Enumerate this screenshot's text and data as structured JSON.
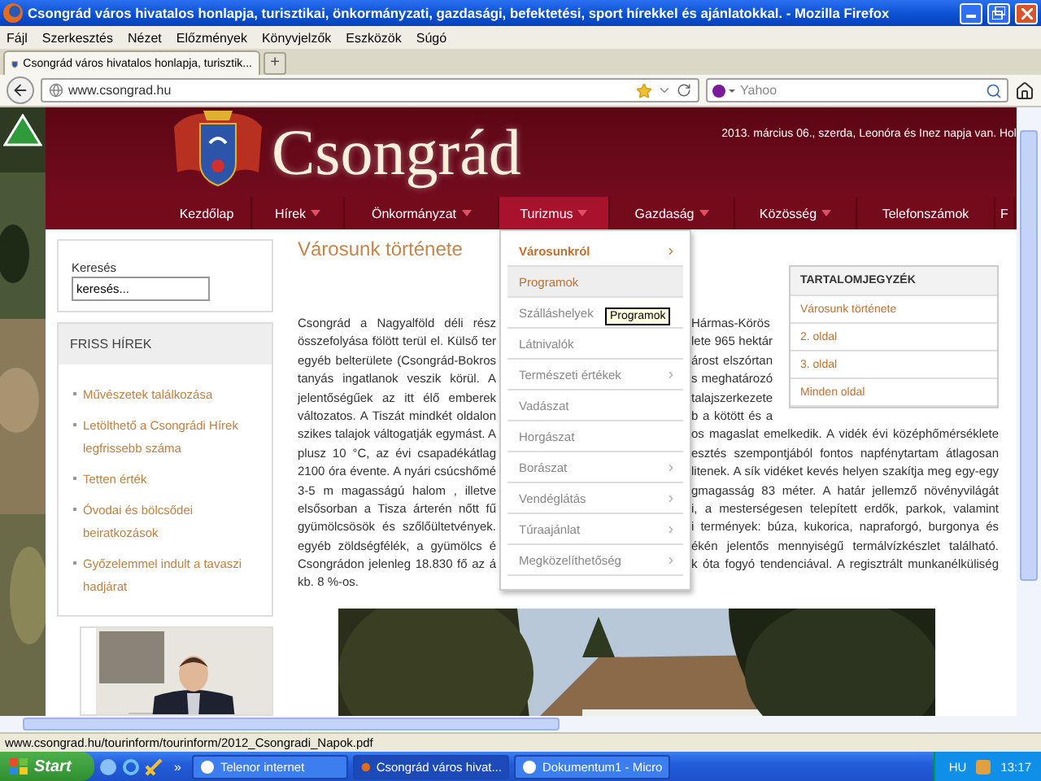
{
  "window": {
    "title": "Csongrád város hivatalos honlapja, turisztikai, önkormányzati, gazdasági, befektetési, sport hírekkel és ajánlatokkal. - Mozilla Firefox"
  },
  "menu_bar": [
    "Fájl",
    "Szerkesztés",
    "Nézet",
    "Előzmények",
    "Könyvjelzők",
    "Eszközök",
    "Súgó"
  ],
  "tabs": [
    {
      "label": "Csongrád város hivatalos honlapja, turisztik...",
      "selected": true
    }
  ],
  "new_tab": "+",
  "address_bar": {
    "url": "www.csongrad.hu"
  },
  "search_bar": {
    "placeholder": "Yahoo"
  },
  "site": {
    "logo_text": "Csongrád",
    "date_line": "2013. március 06., szerda, Leonóra és Inez napja van. Hol",
    "nav": [
      {
        "label": "Kezdőlap",
        "has_submenu": false,
        "selected": false
      },
      {
        "label": "Hírek",
        "has_submenu": true,
        "selected": false
      },
      {
        "label": "Önkormányzat",
        "has_submenu": true,
        "selected": false
      },
      {
        "label": "Turizmus",
        "has_submenu": true,
        "selected": true
      },
      {
        "label": "Gazdaság",
        "has_submenu": true,
        "selected": false
      },
      {
        "label": "Közösség",
        "has_submenu": true,
        "selected": false
      },
      {
        "label": "Telefonszámok",
        "has_submenu": false,
        "selected": false
      },
      {
        "label": "F",
        "has_submenu": false,
        "selected": false
      }
    ],
    "submenu": {
      "tooltip": "Programok",
      "items": [
        {
          "label": "Városunkról",
          "has_submenu": true,
          "active": true,
          "hovered": false
        },
        {
          "label": "Programok",
          "has_submenu": false,
          "active": false,
          "hovered": true
        },
        {
          "label": "Szálláshelyek",
          "has_submenu": false,
          "active": false,
          "hovered": false
        },
        {
          "label": "Látnivalók",
          "has_submenu": false,
          "active": false,
          "hovered": false
        },
        {
          "label": "Természeti értékek",
          "has_submenu": true,
          "active": false,
          "hovered": false
        },
        {
          "label": "Vadászat",
          "has_submenu": false,
          "active": false,
          "hovered": false
        },
        {
          "label": "Horgászat",
          "has_submenu": false,
          "active": false,
          "hovered": false
        },
        {
          "label": "Borászat",
          "has_submenu": true,
          "active": false,
          "hovered": false
        },
        {
          "label": "Vendéglátás",
          "has_submenu": true,
          "active": false,
          "hovered": false
        },
        {
          "label": "Túraajánlat",
          "has_submenu": true,
          "active": false,
          "hovered": false
        },
        {
          "label": "Megközelíthetőség",
          "has_submenu": true,
          "active": false,
          "hovered": false
        }
      ]
    },
    "search": {
      "label": "Keresés",
      "value": "keresés..."
    },
    "news": {
      "title": "FRISS HÍREK",
      "items": [
        "Művészetek találkozása",
        "Letölthető a Csongrádi Hírek legfrissebb száma",
        "Tetten érték",
        "Óvodai és bölcsődei beiratkozások",
        "Győzelemmel indult a tavaszi hadjárat"
      ]
    },
    "article": {
      "title": "Városunk története",
      "lines": [
        {
          "left": "Csongrád a Nagyalföld déli rész",
          "right": "Hármas-Körös"
        },
        {
          "left": "összefolyása fölött terül el. Külső ter",
          "right": "lete 965 hektár"
        },
        {
          "left": "egyéb belterülete (Csongrád-Bokros",
          "right": "árost elszórtan"
        },
        {
          "left": "tanyás ingatlanok veszik körül. A",
          "right": "s meghatározó"
        },
        {
          "left": "jelentőségűek az itt élő emberek",
          "right": "talajszerkezete"
        },
        {
          "left": "változatos. A Tiszát mindkét oldalon",
          "right": "b a kötött és a"
        },
        {
          "left": "szikes talajok váltogatják egymást. A",
          "right": "os magaslat emelkedik. A vidék évi középhőmérséklete"
        },
        {
          "left": "plusz 10 °C, az évi csapadékátlag",
          "right": "esztés szempontjából fontos napfénytartam átlagosan"
        },
        {
          "left": "2100 óra évente. A nyári csúcshőmé",
          "right": "litenek. A sík vidéket kevés helyen szakítja meg egy-egy"
        },
        {
          "left": "3-5 m magasságú halom , illetve",
          "right": "gmagasság 83 méter. A határ jellemző növényvilágát"
        },
        {
          "left": "elsősorban a Tisza árterén nőtt fű",
          "right": "i, a mesterségesen telepített erdők, parkok, valamint"
        },
        {
          "left": "gyümölcsösök és szőlőültetvények.",
          "right": "i termények: búza, kukorica, napraforgó, burgonya és"
        },
        {
          "left": "egyéb zöldségfélék, a gyümölcs é",
          "right": "ékén jelentős mennyiségű termálvízkészlet található."
        },
        {
          "left": "Csongrádon jelenleg 18.830 fő az á",
          "right": "k óta fogyó tendenciával. A regisztrált munkanélküliség"
        },
        {
          "left": "kb. 8 %-os."
        }
      ]
    },
    "toc": {
      "title": "TARTALOMJEGYZÉK",
      "items": [
        "Városunk története",
        "2. oldal",
        "3. oldal",
        "Minden oldal"
      ]
    }
  },
  "status_bar": "www.csongrad.hu/tourinform/tourinform/2012_Csongradi_Napok.pdf",
  "taskbar": {
    "start": "Start",
    "more": "»",
    "tasks": [
      {
        "label": "Telenor internet",
        "selected": false
      },
      {
        "label": "Csongrád város hivat...",
        "selected": true
      },
      {
        "label": "Dokumentum1 - Micro",
        "selected": false
      }
    ],
    "language": "HU",
    "clock": "13:17"
  }
}
